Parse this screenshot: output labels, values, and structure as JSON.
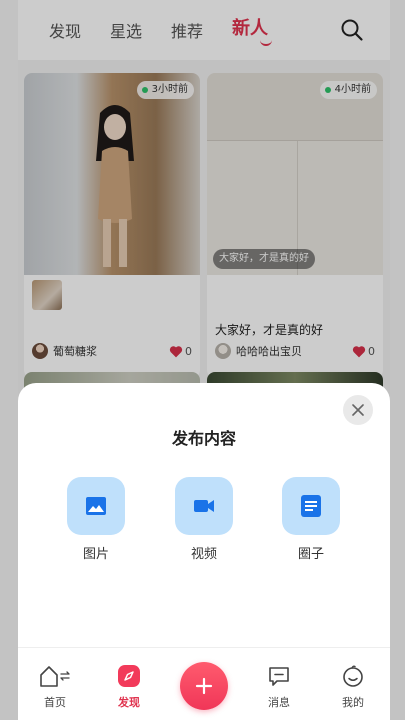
{
  "top_tabs": [
    {
      "label": "发现"
    },
    {
      "label": "星选"
    },
    {
      "label": "推荐"
    },
    {
      "label": "新人",
      "active": true
    }
  ],
  "feed": {
    "cards": [
      {
        "time": "3小时前",
        "author": "葡萄糖浆",
        "likes": "0"
      },
      {
        "time": "4小时前",
        "overlay_caption": "大家好，才是真的好",
        "title": "大家好，才是真的好",
        "author": "哈哈哈出宝贝",
        "likes": "0"
      }
    ]
  },
  "sheet": {
    "title": "发布内容",
    "options": [
      {
        "label": "图片",
        "icon": "image-icon"
      },
      {
        "label": "视频",
        "icon": "video-camera-icon"
      },
      {
        "label": "圈子",
        "icon": "document-icon"
      }
    ]
  },
  "bottom_nav": {
    "items": [
      {
        "label": "首页",
        "icon": "home-icon"
      },
      {
        "label": "发现",
        "icon": "compass-icon",
        "active": true
      },
      {
        "label": "消息",
        "icon": "message-icon"
      },
      {
        "label": "我的",
        "icon": "smile-face-icon"
      }
    ],
    "compose_icon": "plus-icon"
  },
  "colors": {
    "accent": "#e0334e",
    "option_tile": "#bfe0fb",
    "option_icon": "#1a73e8",
    "online_dot": "#2ec26a"
  }
}
